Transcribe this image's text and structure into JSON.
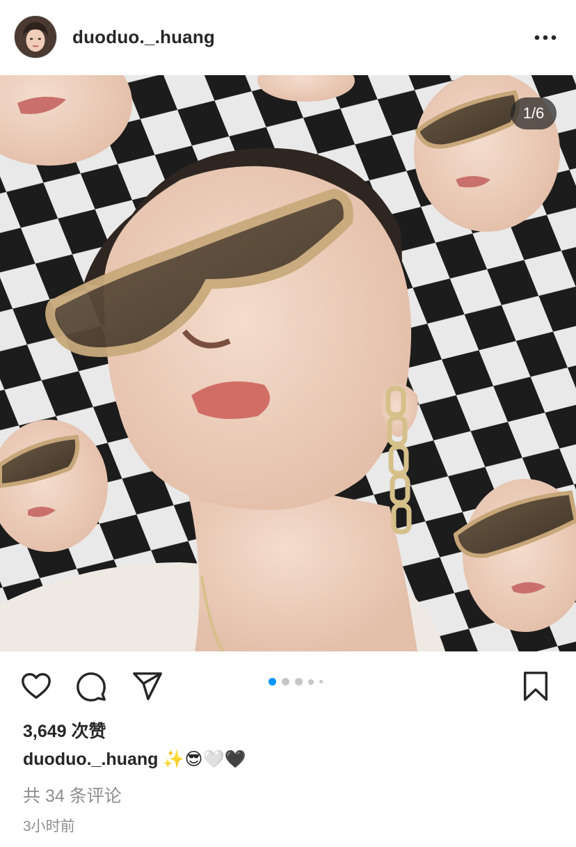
{
  "post": {
    "username": "duoduo._.huang",
    "image_counter": "1/6",
    "likes_text": "3,649 次赞",
    "caption_username": "duoduo._.huang",
    "caption_text": "✨😎🤍🖤",
    "comments_text": "共 34 条评论",
    "time_text": "3小时前"
  },
  "icons": {
    "more": "more-horizontal-icon",
    "like": "heart-icon",
    "comment": "comment-icon",
    "share": "send-icon",
    "save": "bookmark-icon"
  },
  "carousel": {
    "total_dots": 5,
    "active_index": 0
  },
  "colors": {
    "active_dot": "#0095f6",
    "inactive_dot": "#c7c7c7",
    "text": "#262626",
    "muted": "#8e8e8e"
  }
}
